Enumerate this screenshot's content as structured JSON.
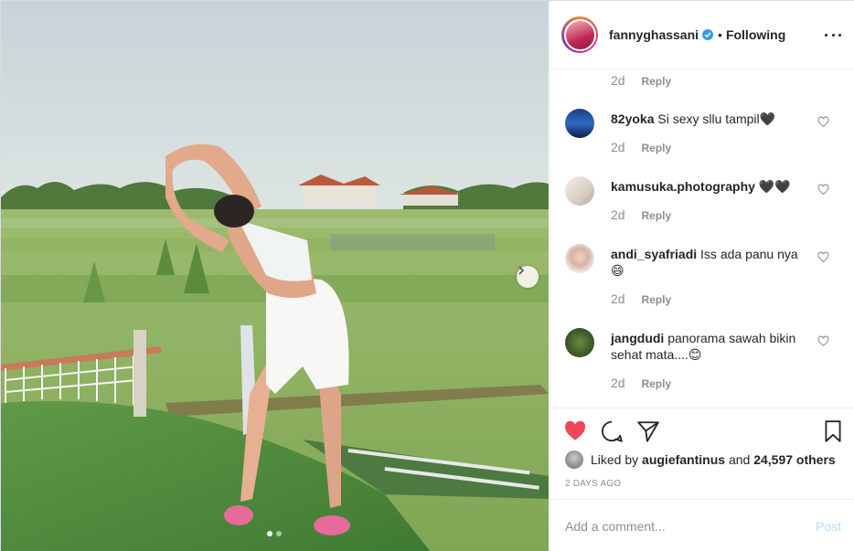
{
  "post": {
    "username": "fannyghassani",
    "separator": "•",
    "follow_status": "Following",
    "more_icon": "more-horizontal-icon",
    "verified_color": "#3897f0"
  },
  "comments": {
    "top_partial": {
      "time": "2d",
      "reply": "Reply"
    },
    "items": [
      {
        "username": "82yoka",
        "text": "Si sexy sllu tampil🖤",
        "time": "2d",
        "reply": "Reply"
      },
      {
        "username": "kamusuka.photography",
        "text": "🖤🖤",
        "time": "2d",
        "reply": "Reply"
      },
      {
        "username": "andi_syafriadi",
        "text": "Iss ada panu nya 😄",
        "time": "2d",
        "reply": "Reply"
      },
      {
        "username": "jangdudi",
        "text": "panorama sawah bikin sehat mata....😊",
        "time": "2d",
        "reply": "Reply"
      }
    ]
  },
  "actions": {
    "like_icon": "heart-filled-icon",
    "comment_icon": "comment-icon",
    "share_icon": "share-icon",
    "save_icon": "bookmark-icon",
    "like_color": "#ed4956",
    "liked_by_prefix": "Liked by",
    "liked_by_user": "augiefantinus",
    "liked_by_mid": "and",
    "liked_by_count": "24,597 others",
    "time_ago": "2 DAYS AGO"
  },
  "add_comment": {
    "placeholder": "Add a comment...",
    "post_label": "Post"
  },
  "carousel": {
    "next_icon": "chevron-right-icon",
    "total_slides": 2,
    "active_slide": 1
  }
}
